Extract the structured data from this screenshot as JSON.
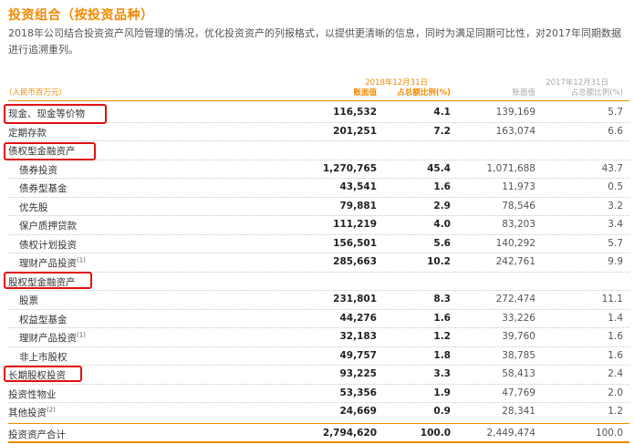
{
  "title": "投资组合（按投资品种）",
  "intro": "2018年公司结合投资资产风险管理的情况，优化投资资产的列报格式，以提供更清晰的信息，同时为满足同期可比性，对2017年同期数据进行追溯重列。",
  "header": {
    "unit": "（人民币百万元）",
    "period_current": "2018年12月31日",
    "period_prior": "2017年12月31日",
    "col_carrying": "账面值",
    "col_pct": "占总额比例(%)"
  },
  "rows": [
    {
      "label": "现金、现金等价物",
      "sup": "",
      "v2018": "116,532",
      "p2018": "4.1",
      "v2017": "139,169",
      "p2017": "5.7"
    },
    {
      "label": "定期存款",
      "sup": "",
      "v2018": "201,251",
      "p2018": "7.2",
      "v2017": "163,074",
      "p2017": "6.6"
    },
    {
      "label": "债权型金融资产",
      "sup": "",
      "v2018": "",
      "p2018": "",
      "v2017": "",
      "p2017": ""
    },
    {
      "label": "债券投资",
      "sup": "",
      "v2018": "1,270,765",
      "p2018": "45.4",
      "v2017": "1,071,688",
      "p2017": "43.7"
    },
    {
      "label": "债券型基金",
      "sup": "",
      "v2018": "43,541",
      "p2018": "1.6",
      "v2017": "11,973",
      "p2017": "0.5"
    },
    {
      "label": "优先股",
      "sup": "",
      "v2018": "79,881",
      "p2018": "2.9",
      "v2017": "78,546",
      "p2017": "3.2"
    },
    {
      "label": "保户质押贷款",
      "sup": "",
      "v2018": "111,219",
      "p2018": "4.0",
      "v2017": "83,203",
      "p2017": "3.4"
    },
    {
      "label": "债权计划投资",
      "sup": "",
      "v2018": "156,501",
      "p2018": "5.6",
      "v2017": "140,292",
      "p2017": "5.7"
    },
    {
      "label": "理财产品投资",
      "sup": "(1)",
      "v2018": "285,663",
      "p2018": "10.2",
      "v2017": "242,761",
      "p2017": "9.9"
    },
    {
      "label": "股权型金融资产",
      "sup": "",
      "v2018": "",
      "p2018": "",
      "v2017": "",
      "p2017": ""
    },
    {
      "label": "股票",
      "sup": "",
      "v2018": "231,801",
      "p2018": "8.3",
      "v2017": "272,474",
      "p2017": "11.1"
    },
    {
      "label": "权益型基金",
      "sup": "",
      "v2018": "44,276",
      "p2018": "1.6",
      "v2017": "33,226",
      "p2017": "1.4"
    },
    {
      "label": "理财产品投资",
      "sup": "(1)",
      "v2018": "32,183",
      "p2018": "1.2",
      "v2017": "39,760",
      "p2017": "1.6"
    },
    {
      "label": "非上市股权",
      "sup": "",
      "v2018": "49,757",
      "p2018": "1.8",
      "v2017": "38,785",
      "p2017": "1.6"
    },
    {
      "label": "长期股权投资",
      "sup": "",
      "v2018": "93,225",
      "p2018": "3.3",
      "v2017": "58,413",
      "p2017": "2.4"
    },
    {
      "label": "投资性物业",
      "sup": "",
      "v2018": "53,356",
      "p2018": "1.9",
      "v2017": "47,769",
      "p2017": "2.0"
    },
    {
      "label": "其他投资",
      "sup": "(2)",
      "v2018": "24,669",
      "p2018": "0.9",
      "v2017": "28,341",
      "p2017": "1.2"
    },
    {
      "label": "投资资产合计",
      "sup": "",
      "v2018": "2,794,620",
      "p2018": "100.0",
      "v2017": "2,449,474",
      "p2017": "100.0"
    }
  ],
  "colors": {
    "accent": "#f08a00",
    "highlight": "#e01010"
  }
}
